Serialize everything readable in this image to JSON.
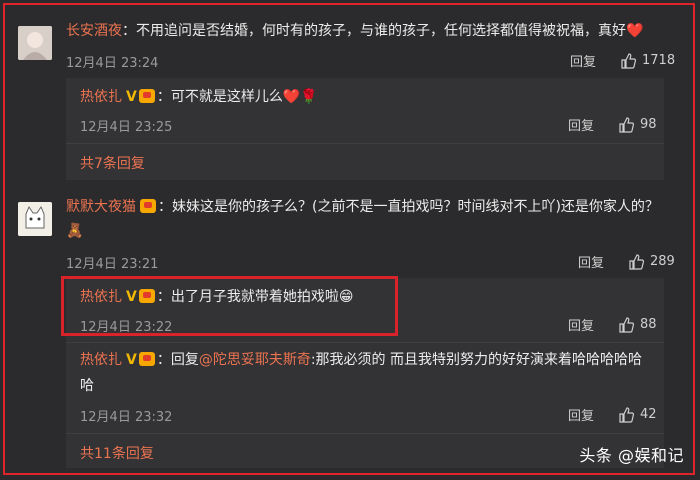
{
  "comments": [
    {
      "user": "长安酒夜",
      "text": "：不用追问是否结婚，何时有的孩子，与谁的孩子，任何选择都值得被祝福，真好",
      "emoji": "❤️",
      "time": "12月4日 23:24",
      "reply_label": "回复",
      "likes": "1718"
    },
    {
      "user": "默默大夜猫",
      "text": "：妹妹这是你的孩子么？(之前不是一直拍戏吗？时间线对不上吖)还是你家人的？",
      "emoji": "🧸",
      "time": "12月4日 23:21",
      "reply_label": "回复",
      "likes": "289"
    }
  ],
  "replies": [
    {
      "user": "热依扎",
      "text": "：可不就是这样儿么",
      "emoji": "❤️🌹",
      "time": "12月4日 23:25",
      "reply_label": "回复",
      "likes": "98"
    },
    {
      "user": "热依扎",
      "text": "：出了月子我就带着她拍戏啦",
      "emoji": "😁",
      "time": "12月4日 23:22",
      "reply_label": "回复",
      "likes": "88"
    },
    {
      "user": "热依扎",
      "text_prefix": "：回复",
      "mention": "@陀思妥耶夫斯奇",
      "text": ":那我必须的 而且我特别努力的好好演来着哈哈哈哈哈",
      "text_line2": "哈",
      "time": "12月4日 23:32",
      "reply_label": "回复",
      "likes": "42"
    }
  ],
  "more_links": [
    "共7条回复",
    "共11条回复"
  ],
  "watermark": "头条 @娱和记",
  "colors": {
    "username": "#eb7350",
    "highlight": "#d8232a",
    "background": "#2b2b2d"
  }
}
